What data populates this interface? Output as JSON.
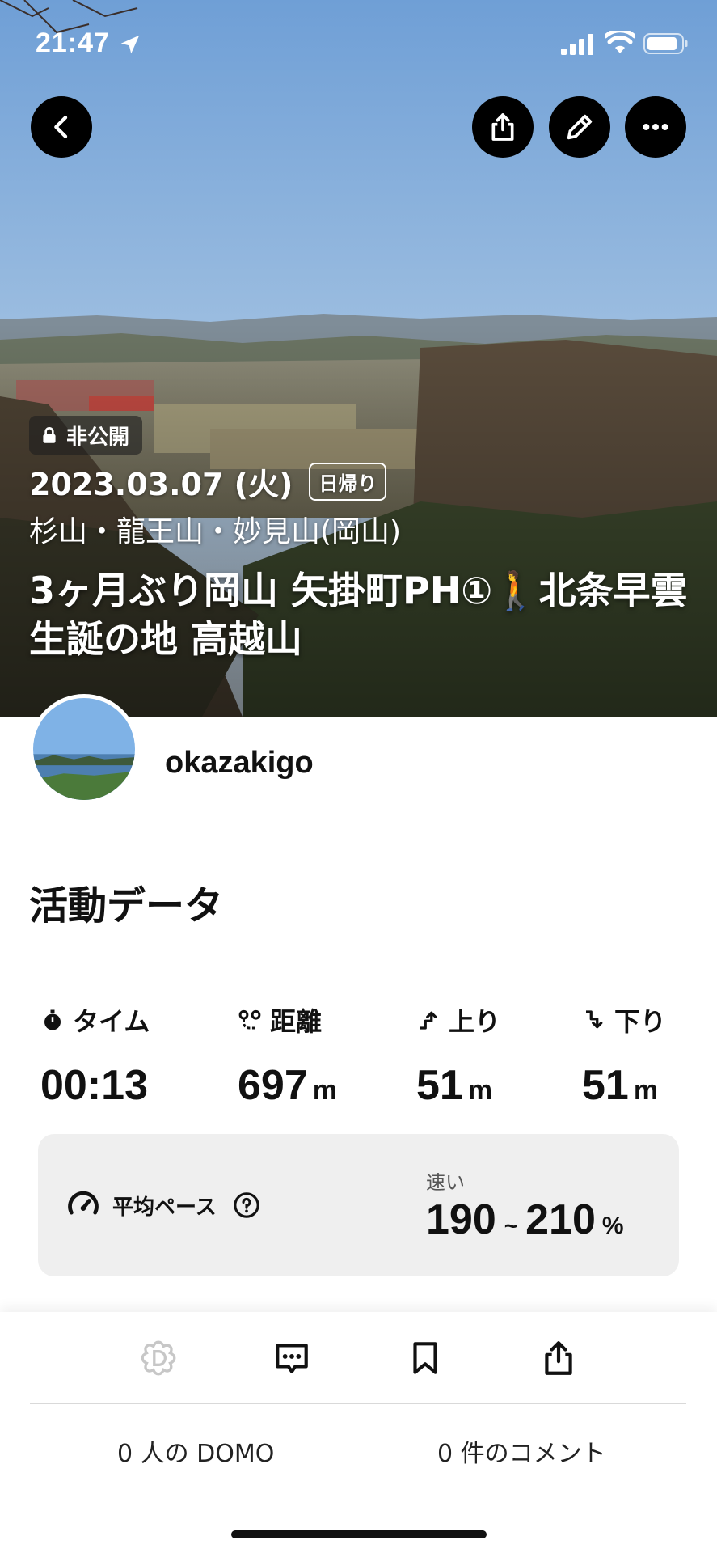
{
  "status_bar": {
    "time": "21:47"
  },
  "header": {
    "private_badge": "非公開",
    "date": "2023.03.07 (火)",
    "trip_type": "日帰り",
    "mountains": "杉山・龍王山・妙見山(岡山)",
    "title": "3ヶ月ぶり岡山 矢掛町PH①🚶北条早雲生誕の地 高越山"
  },
  "user": {
    "username": "okazakigo"
  },
  "activity": {
    "section_title": "活動データ",
    "stats": {
      "time": {
        "label": "タイム",
        "value": "00:13",
        "unit": ""
      },
      "distance": {
        "label": "距離",
        "value": "697",
        "unit": "m"
      },
      "ascent": {
        "label": "上り",
        "value": "51",
        "unit": "m"
      },
      "descent": {
        "label": "下り",
        "value": "51",
        "unit": "m"
      }
    },
    "pace": {
      "label": "平均ペース",
      "speed_label": "速い",
      "min": "190",
      "tilde": "~",
      "max": "210",
      "unit": "%"
    }
  },
  "actions": {
    "domo_count": "0 人の DOMO",
    "comment_count": "0 件のコメント"
  },
  "icons": [
    "location-arrow-icon",
    "signal-icon",
    "wifi-icon",
    "battery-icon",
    "back-icon",
    "share-icon",
    "edit-pencil-icon",
    "more-icon",
    "lock-icon",
    "stopwatch-icon",
    "distance-icon",
    "ascent-icon",
    "descent-icon",
    "gauge-icon",
    "help-icon",
    "domo-icon",
    "comment-icon",
    "bookmark-icon"
  ],
  "colors": {
    "overlay_button": "#000000",
    "card_bg": "#efefef",
    "sky": "#8db5df"
  }
}
